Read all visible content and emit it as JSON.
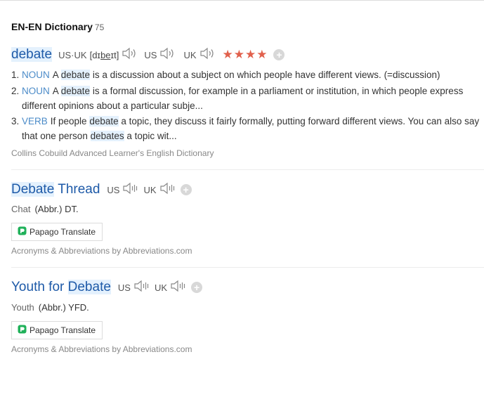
{
  "header": {
    "title": "EN-EN Dictionary",
    "count": "75"
  },
  "entry1": {
    "word": "debate",
    "pron_label": "US·UK",
    "pron_a": "[dɪ",
    "pron_u": "be",
    "pron_b": "ɪt]",
    "us": "US",
    "uk": "UK",
    "stars": "★★★★",
    "defs": [
      {
        "num": "1.",
        "pos": "NOUN",
        "pre": "A ",
        "kw": "debate",
        "post": " is a discussion about a subject on which people have different views. (=discussion)"
      },
      {
        "num": "2.",
        "pos": "NOUN",
        "pre": "A ",
        "kw": "debate",
        "post": " is a formal discussion, for example in a parliament or institution, in which people express different opinions about a particular subje..."
      },
      {
        "num": "3.",
        "pos": "VERB",
        "pre": "If people ",
        "kw": "debate",
        "post": " a topic, they discuss it fairly formally, putting forward different views. You can also say that one person ",
        "kw2": "debates",
        "post2": " a topic wit..."
      }
    ],
    "source": "Collins Cobuild Advanced Learner's English Dictionary"
  },
  "entry2": {
    "word_hl": "Debate",
    "word_rest": " Thread",
    "us": "US",
    "uk": "UK",
    "key": "Chat",
    "abbr": "(Abbr.) DT.",
    "translate": "Papago Translate",
    "source": "Acronyms & Abbreviations by Abbreviations.com"
  },
  "entry3": {
    "word_pre": "Youth for ",
    "word_hl": "Debate",
    "us": "US",
    "uk": "UK",
    "key": "Youth",
    "abbr": "(Abbr.) YFD.",
    "translate": "Papago Translate",
    "source": "Acronyms & Abbreviations by Abbreviations.com"
  },
  "colors": {
    "link": "#1e5aa8",
    "pos": "#4b8bc8",
    "stars": "#e1604c",
    "highlight": "#e4f1fd"
  },
  "icons": [
    "speaker-icon",
    "plus-icon",
    "papago-icon"
  ]
}
